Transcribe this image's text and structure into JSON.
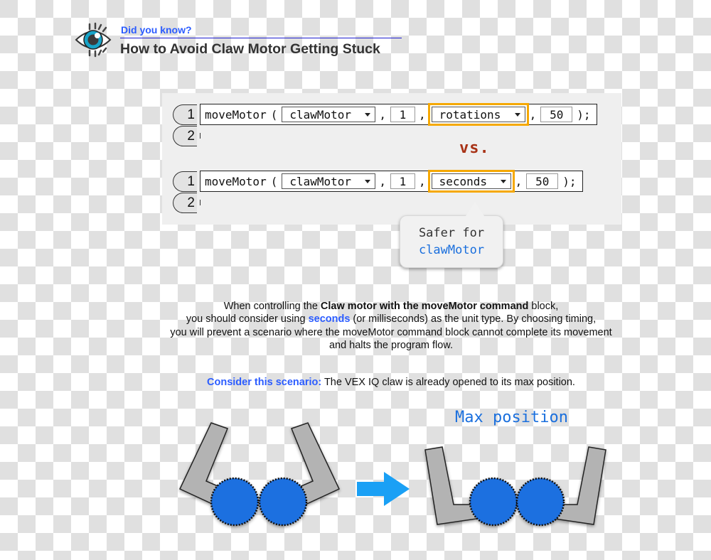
{
  "header": {
    "kicker": "Did you know?",
    "title": "How to Avoid Claw Motor Getting Stuck",
    "icon": "eye-icon"
  },
  "code_examples": [
    {
      "lines": [
        "1",
        "2"
      ],
      "command": "moveMotor",
      "open_paren": "(",
      "motor": "clawMotor",
      "comma": ",",
      "amount": "1",
      "unit": "rotations",
      "speed": "50",
      "close": ");"
    },
    {
      "lines": [
        "1",
        "2"
      ],
      "command": "moveMotor",
      "open_paren": "(",
      "motor": "clawMotor",
      "comma": ",",
      "amount": "1",
      "unit": "seconds",
      "speed": "50",
      "close": ");"
    }
  ],
  "vs_label": "vs.",
  "tooltip": {
    "line1": "Safer for",
    "line2": "clawMotor"
  },
  "explanation": {
    "p1_a": "When controlling the ",
    "p1_bold": "Claw motor with the moveMotor command",
    "p1_b": " block,",
    "p2_a": "you should consider using ",
    "p2_highlight": "seconds",
    "p2_b": " (or milliseconds) as the unit type. By choosing timing,",
    "p3": "you will prevent a scenario where the moveMotor command block cannot complete its movement",
    "p4": "and halts the program flow."
  },
  "scenario": {
    "label": "Consider this scenario:",
    "text": " The VEX IQ claw is already opened to its max position."
  },
  "diagram": {
    "max_position_label": "Max position",
    "colors": {
      "gear": "#1f6fe0",
      "arm": "#b3b3b3",
      "arrow": "#1aa0f5",
      "highlight": "#f5a800"
    }
  }
}
